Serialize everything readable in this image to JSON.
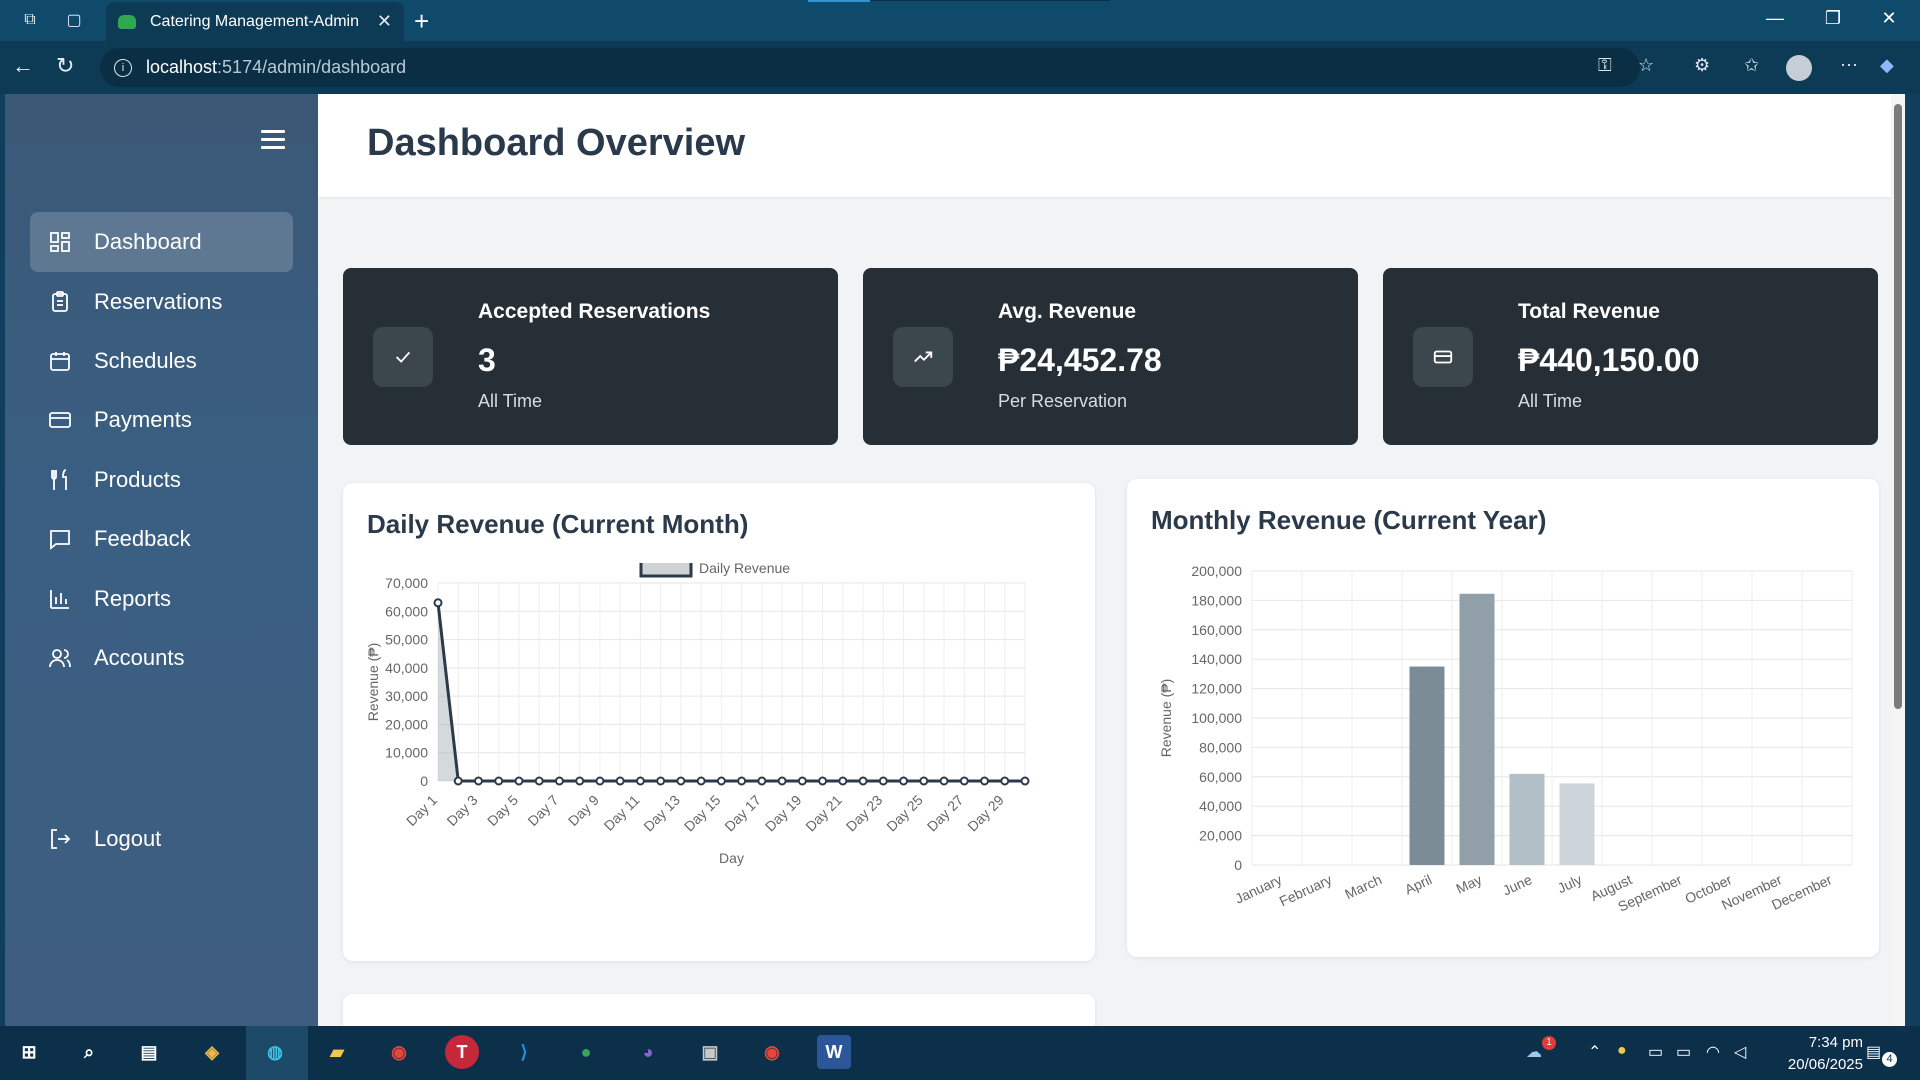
{
  "browser": {
    "tab_title": "Catering Management-Admin",
    "url_host": "localhost",
    "url_path": ":5174/admin/dashboard"
  },
  "sidebar": {
    "items": [
      {
        "label": "Dashboard",
        "icon": "dashboard-icon"
      },
      {
        "label": "Reservations",
        "icon": "clipboard-icon"
      },
      {
        "label": "Schedules",
        "icon": "calendar-icon"
      },
      {
        "label": "Payments",
        "icon": "credit-card-icon"
      },
      {
        "label": "Products",
        "icon": "utensils-icon"
      },
      {
        "label": "Feedback",
        "icon": "message-icon"
      },
      {
        "label": "Reports",
        "icon": "bar-chart-icon"
      },
      {
        "label": "Accounts",
        "icon": "users-icon"
      }
    ],
    "logout_label": "Logout"
  },
  "header": {
    "title": "Dashboard Overview"
  },
  "stats": [
    {
      "label": "Accepted Reservations",
      "value": "3",
      "sub": "All Time",
      "icon": "check-icon"
    },
    {
      "label": "Avg. Revenue",
      "value": "₱24,452.78",
      "sub": "Per Reservation",
      "icon": "trending-up-icon"
    },
    {
      "label": "Total Revenue",
      "value": "₱440,150.00",
      "sub": "All Time",
      "icon": "credit-card-icon"
    }
  ],
  "chart_data": [
    {
      "type": "line",
      "title": "Daily Revenue (Current Month)",
      "legend": "Daily Revenue",
      "legend_position": "top",
      "xlabel": "Day",
      "ylabel": "Revenue (₱)",
      "ylim": [
        0,
        70000
      ],
      "yticks": [
        "70,000",
        "60,000",
        "50,000",
        "40,000",
        "30,000",
        "20,000",
        "10,000",
        "0"
      ],
      "xticklabels": [
        "Day 1",
        "Day 3",
        "Day 5",
        "Day 7",
        "Day 9",
        "Day 11",
        "Day 13",
        "Day 15",
        "Day 17",
        "Day 19",
        "Day 21",
        "Day 23",
        "Day 25",
        "Day 27",
        "Day 29"
      ],
      "x": [
        1,
        2,
        3,
        4,
        5,
        6,
        7,
        8,
        9,
        10,
        11,
        12,
        13,
        14,
        15,
        16,
        17,
        18,
        19,
        20,
        21,
        22,
        23,
        24,
        25,
        26,
        27,
        28,
        29,
        30
      ],
      "values": [
        63000,
        0,
        0,
        0,
        0,
        0,
        0,
        0,
        0,
        0,
        0,
        0,
        0,
        0,
        0,
        0,
        0,
        0,
        0,
        0,
        0,
        0,
        0,
        0,
        0,
        0,
        0,
        0,
        0,
        0
      ],
      "grid": true
    },
    {
      "type": "bar",
      "title": "Monthly Revenue (Current Year)",
      "ylabel": "Revenue (₱)",
      "ylim": [
        0,
        200000
      ],
      "yticks": [
        "200,000",
        "180,000",
        "160,000",
        "140,000",
        "120,000",
        "100,000",
        "80,000",
        "60,000",
        "40,000",
        "20,000",
        "0"
      ],
      "categories": [
        "January",
        "February",
        "March",
        "April",
        "May",
        "June",
        "July",
        "August",
        "September",
        "October",
        "November",
        "December"
      ],
      "values": [
        0,
        0,
        0,
        135000,
        184500,
        62000,
        55500,
        0,
        0,
        0,
        0,
        0
      ],
      "bar_colors": [
        "#7b8c97",
        "#7b8c97",
        "#7b8c97",
        "#7b8c97",
        "#909fa8",
        "#b2bfc6",
        "#cdd5da",
        "#cdd5da",
        "#cdd5da",
        "#cdd5da",
        "#cdd5da",
        "#cdd5da"
      ],
      "grid": true
    }
  ],
  "taskbar": {
    "time": "7:34 pm",
    "date": "20/06/2025",
    "notification_count": "4",
    "weather_badge": "1"
  },
  "colors": {
    "sidebar": "#3a5a7c",
    "stat_card": "#262f35",
    "title_text": "#2b3a4a"
  }
}
